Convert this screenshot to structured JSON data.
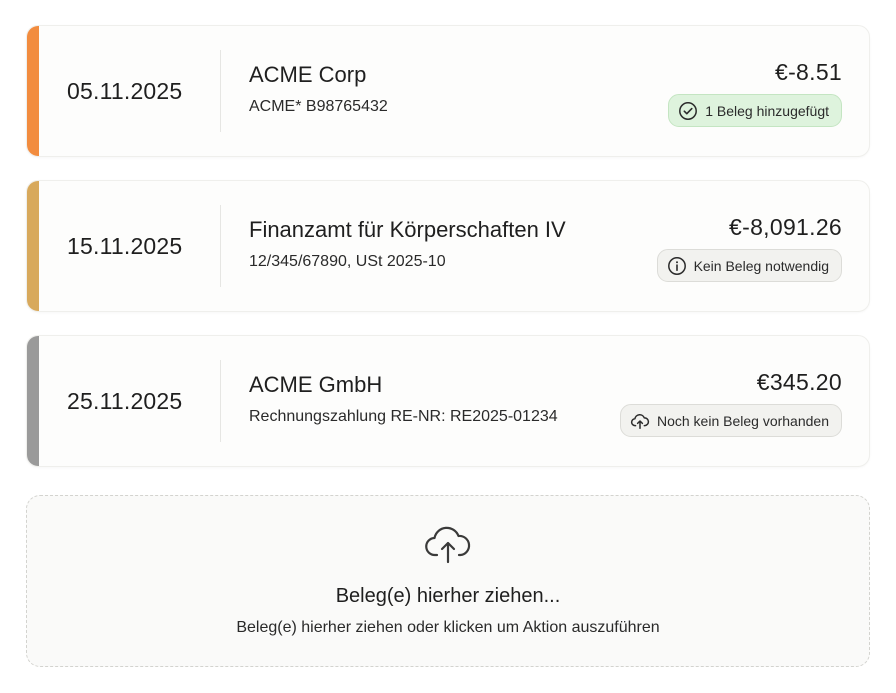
{
  "transactions": [
    {
      "date": "05.11.2025",
      "merchant": "ACME Corp",
      "reference": "ACME* B98765432",
      "amount": "€-8.51",
      "status": {
        "label": "1 Beleg hinzugefügt",
        "icon": "check-circle-icon",
        "kind": "ok"
      },
      "accent_color": "#f28c3f"
    },
    {
      "date": "15.11.2025",
      "merchant": "Finanzamt für Körperschaften IV",
      "reference": "12/345/67890, USt 2025-10",
      "amount": "€-8,091.26",
      "status": {
        "label": "Kein Beleg notwendig",
        "icon": "info-icon",
        "kind": "neutral"
      },
      "accent_color": "#d8a95c"
    },
    {
      "date": "25.11.2025",
      "merchant": "ACME GmbH",
      "reference": "Rechnungszahlung RE-NR: RE2025-01234",
      "amount": "€345.20",
      "status": {
        "label": "Noch kein Beleg vorhanden",
        "icon": "cloud-upload-icon",
        "kind": "neutral"
      },
      "accent_color": "#9a9a9a"
    }
  ],
  "dropzone": {
    "icon": "cloud-upload-icon",
    "title": "Beleg(e) hierher ziehen...",
    "subtitle": "Beleg(e) hierher ziehen oder klicken um Aktion auszuführen"
  },
  "colors": {
    "success_badge_bg": "#def3dd",
    "neutral_badge_bg": "#f2f2ef",
    "card_border": "#efefec"
  }
}
